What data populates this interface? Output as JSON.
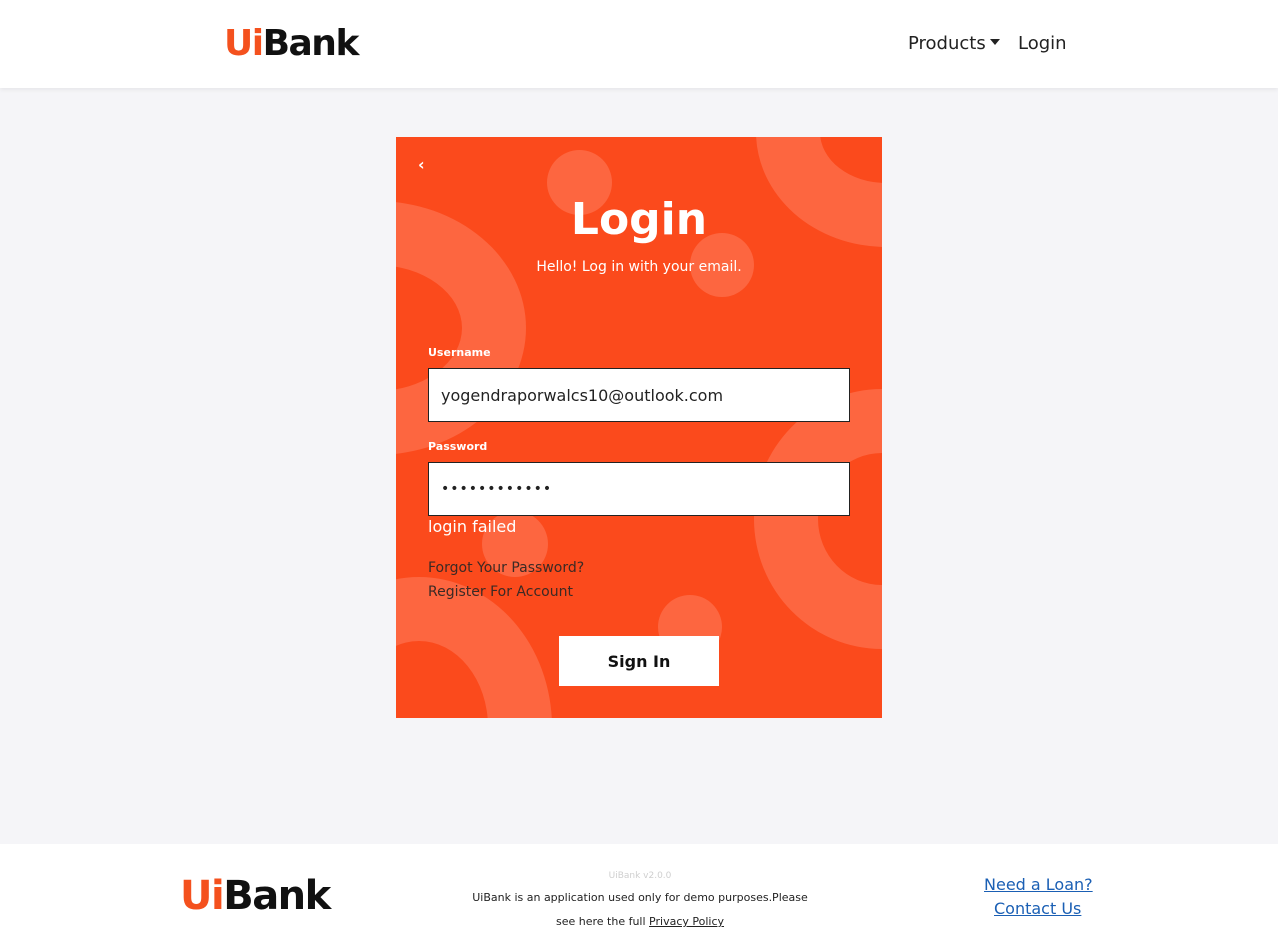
{
  "brand": {
    "logo_ui": "Ui",
    "logo_bank": "Bank",
    "accent": "#fb4a1c",
    "dark": "#111111"
  },
  "nav": {
    "products_label": "Products",
    "login_label": "Login"
  },
  "card": {
    "back_icon": "‹",
    "title": "Login",
    "subtitle": "Hello! Log in with your email.",
    "username_label": "Username",
    "username_value": "yogendraporwalcs10@outlook.com",
    "password_label": "Password",
    "password_value": "••••••••••••",
    "error_message": "login failed",
    "forgot_link": "Forgot Your Password?",
    "register_link": "Register For Account",
    "signin_label": "Sign In"
  },
  "footer": {
    "version": "UiBank v2.0.0",
    "description_line1": "UiBank is an application used only for demo purposes.Please",
    "description_line2_prefix": "see here the full ",
    "privacy_link": "Privacy Policy",
    "loan_link": "Need a Loan?",
    "contact_link": "Contact Us"
  }
}
